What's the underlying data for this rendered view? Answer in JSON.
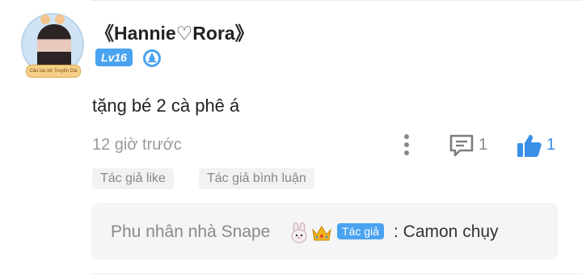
{
  "comment": {
    "username": "《Hannie♡Rora》",
    "level": "Lv16",
    "avatar_banner": "Câu lạc bộ Truyện Dài",
    "text": "tặng bé 2 cà phê á",
    "timestamp": "12 giờ trước",
    "reply_count": "1",
    "like_count": "1",
    "tags": [
      "Tác giả like",
      "Tác giả bình luận"
    ]
  },
  "reply": {
    "author": "Phu nhân nhà Snape",
    "author_badge": "Tác giả",
    "text": ": Camon chụy"
  },
  "colors": {
    "accent": "#4aa3f0",
    "like": "#3b8fe6",
    "muted": "#9a9a9a"
  },
  "icons": [
    "avatar",
    "medal-icon",
    "more-vertical-icon",
    "reply-icon",
    "thumbs-up-icon",
    "rabbit-emoji-icon",
    "crown-emoji-icon"
  ]
}
